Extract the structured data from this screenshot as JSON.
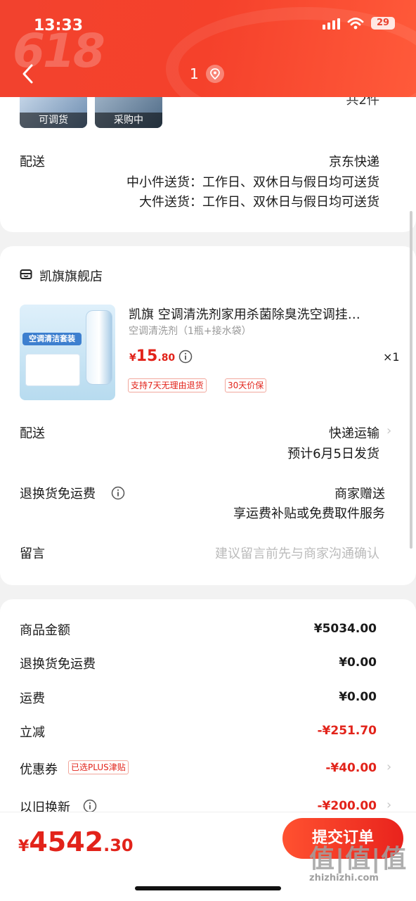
{
  "status_bar": {
    "time": "13:33",
    "battery": "29"
  },
  "header": {
    "promo_text": "618",
    "step_number": "1"
  },
  "prev_store": {
    "thumbs": [
      {
        "label": "可调货"
      },
      {
        "label": "采购中"
      }
    ],
    "more_text": "共2件",
    "delivery": {
      "label": "配送",
      "carrier": "京东快递",
      "line1": "中小件送货：工作日、双休日与假日均可送货",
      "line2": "大件送货：工作日、双休日与假日均可送货"
    }
  },
  "store": {
    "name": "凯旗旗舰店",
    "product": {
      "title": "凯旗 空调清洗剂家用杀菌除臭洗空调挂…",
      "spec": "空调清洗剂（1瓶+接水袋）",
      "price_symbol": "¥",
      "price_int": "15",
      "price_dec": ".80",
      "quantity": "×1",
      "badges": [
        "支持7天无理由退货",
        "30天价保"
      ],
      "image_text": "空调清洁套装"
    },
    "delivery": {
      "label": "配送",
      "method": "快递运输",
      "eta": "预计6月5日发货"
    },
    "return_shipping": {
      "label": "退换货免运费",
      "value": "商家赠送",
      "desc": "享运费补贴或免费取件服务"
    },
    "message": {
      "label": "留言",
      "placeholder": "建议留言前先与商家沟通确认"
    }
  },
  "summary": {
    "rows": [
      {
        "label": "商品金额",
        "value": "¥5034.00"
      },
      {
        "label": "退换货免运费",
        "value": "¥0.00"
      },
      {
        "label": "运费",
        "value": "¥0.00"
      },
      {
        "label": "立减",
        "value": "-¥251.70"
      },
      {
        "label": "优惠券",
        "badge": "已选PLUS津贴",
        "value": "-¥40.00"
      },
      {
        "label": "以旧换新",
        "value": "-¥200.00"
      }
    ]
  },
  "footer": {
    "currency": "¥",
    "total_int": "4542",
    "total_dec": ".30",
    "submit_label": "提交订单",
    "watermark": "值|值|值",
    "watermark_sub": "zhizhizhi.com"
  },
  "colors": {
    "accent": "#e2231a",
    "header": "#f2422e"
  }
}
